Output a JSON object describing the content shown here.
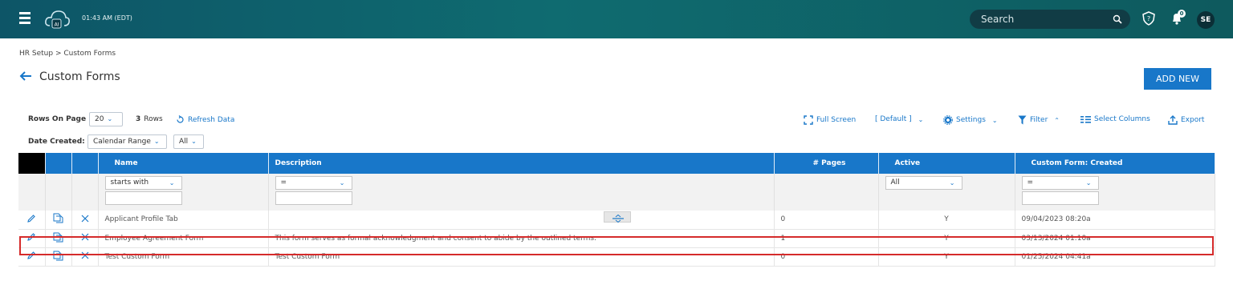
{
  "topbar": {
    "clock": "01:43 AM (EDT)",
    "search_placeholder": "Search",
    "notifications_count": "0",
    "avatar_initials": "SE",
    "logo_text": "AI"
  },
  "breadcrumb": "HR Setup > Custom Forms",
  "page_title": "Custom Forms",
  "add_new_label": "ADD NEW",
  "toolbar": {
    "rows_on_page_label": "Rows On Page",
    "rows_on_page_value": "20",
    "rows_count": "3",
    "rows_label": "Rows",
    "refresh_label": "Refresh Data",
    "full_screen_label": "Full Screen",
    "view_label": "[ Default ]",
    "settings_label": "Settings",
    "filter_label": "Filter",
    "select_columns_label": "Select Columns",
    "export_label": "Export",
    "date_created_label": "Date Created:",
    "calendar_range_value": "Calendar Range",
    "date_all_value": "All"
  },
  "table": {
    "headers": [
      "Name",
      "Description",
      "# Pages",
      "Active",
      "Custom Form: Created"
    ],
    "filters": {
      "name": "starts with",
      "description": "=",
      "active": "All",
      "created": "="
    },
    "rows": [
      {
        "name": "Applicant Profile Tab",
        "description": "",
        "pages": "0",
        "active": "Y",
        "created": "09/04/2023 08:20a"
      },
      {
        "name": "Employee Agreement Form",
        "description": "This form serves as formal acknowledgment and consent to abide by the outlined terms.",
        "pages": "1",
        "active": "Y",
        "created": "03/13/2024 01:10a"
      },
      {
        "name": "Test Custom Form",
        "description": "Test Custom Form",
        "pages": "0",
        "active": "Y",
        "created": "01/25/2024 04:41a"
      }
    ]
  },
  "colors": {
    "accent": "#1877c9",
    "topbar": "#0f6b70",
    "highlight": "#d52b2b"
  }
}
